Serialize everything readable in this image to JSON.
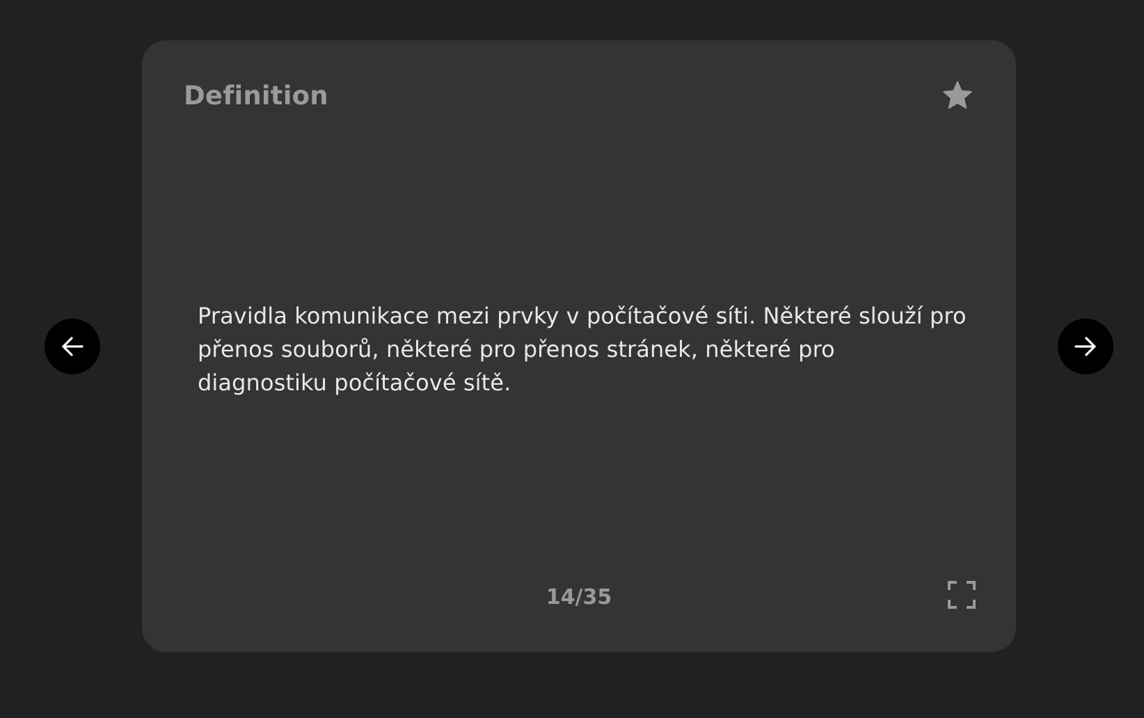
{
  "card": {
    "label": "Definition",
    "text": "Pravidla komunikace mezi prvky v počítačové síti. Některé slouží pro přenos souborů, některé pro přenos stránek, některé pro diagnostiku počítačové sítě.",
    "counter": "14/35"
  },
  "icons": {
    "star": "star-icon",
    "fullscreen": "fullscreen-icon",
    "prev": "arrow-left-icon",
    "next": "arrow-right-icon"
  },
  "colors": {
    "background": "#202121",
    "card": "#343434",
    "muted_text": "#9a9a9a",
    "body_text": "#e8e8e8",
    "nav_button": "#000000"
  }
}
